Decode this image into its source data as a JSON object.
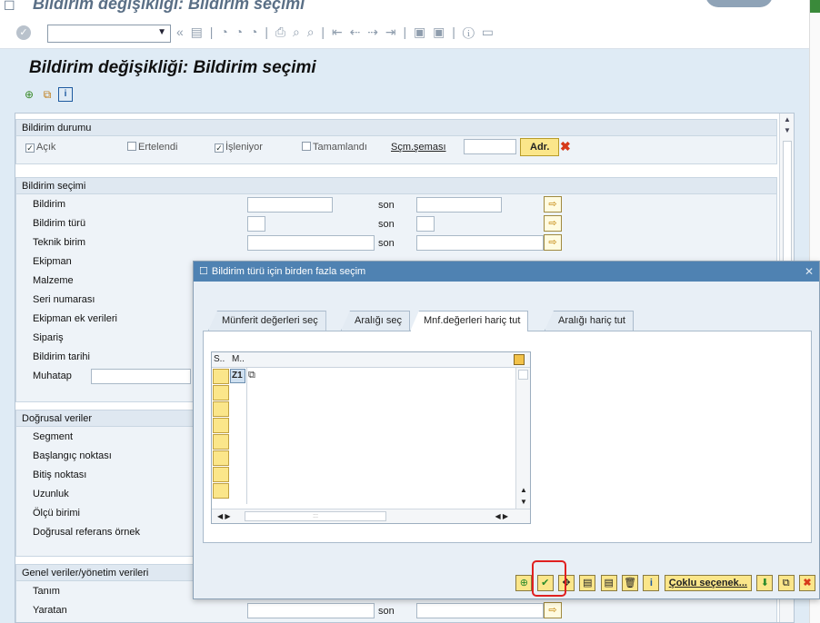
{
  "window": {
    "title": "Bildirim değişikliği: Bildirim seçimi"
  },
  "app": {
    "title": "Bildirim değişikliği: Bildirim seçimi"
  },
  "status_group": {
    "title": "Bildirim durumu",
    "checkboxes": [
      {
        "label": "Açık",
        "checked": true
      },
      {
        "label": "Ertelendi",
        "checked": false
      },
      {
        "label": "İşleniyor",
        "checked": true
      },
      {
        "label": "Tamamlandı",
        "checked": false
      }
    ],
    "scheme_label": "Sçm.şeması",
    "adr_button": "Adr."
  },
  "selection_group": {
    "title": "Bildirim seçimi",
    "fields": [
      "Bildirim",
      "Bildirim türü",
      "Teknik birim",
      "Ekipman",
      "Malzeme",
      "Seri numarası",
      "Ekipman ek verileri",
      "Sipariş",
      "Bildirim tarihi",
      "Muhatap"
    ],
    "to_label": "son"
  },
  "linear_group": {
    "title": "Doğrusal veriler",
    "fields": [
      "Segment",
      "Başlangıç noktası",
      "Bitiş noktası",
      "Uzunluk",
      "Ölçü birimi",
      "Doğrusal referans örnek"
    ]
  },
  "general_group": {
    "title": "Genel veriler/yönetim verileri",
    "fields": [
      "Tanım",
      "Yaratan"
    ],
    "to_label": "son"
  },
  "dialog": {
    "title": "Bildirim türü için birden fazla seçim",
    "tabs": [
      "Münferit değerleri seç",
      "Aralığı seç",
      "Mnf.değerleri hariç tut",
      "Aralığı hariç tut"
    ],
    "active_tab": 2,
    "table": {
      "col1": "S..",
      "col2": "M..",
      "rows": [
        "Z1",
        "",
        "",
        "",
        "",
        "",
        "",
        ""
      ]
    },
    "buttons": {
      "multiple_selection": "Çoklu seçenek..."
    }
  }
}
